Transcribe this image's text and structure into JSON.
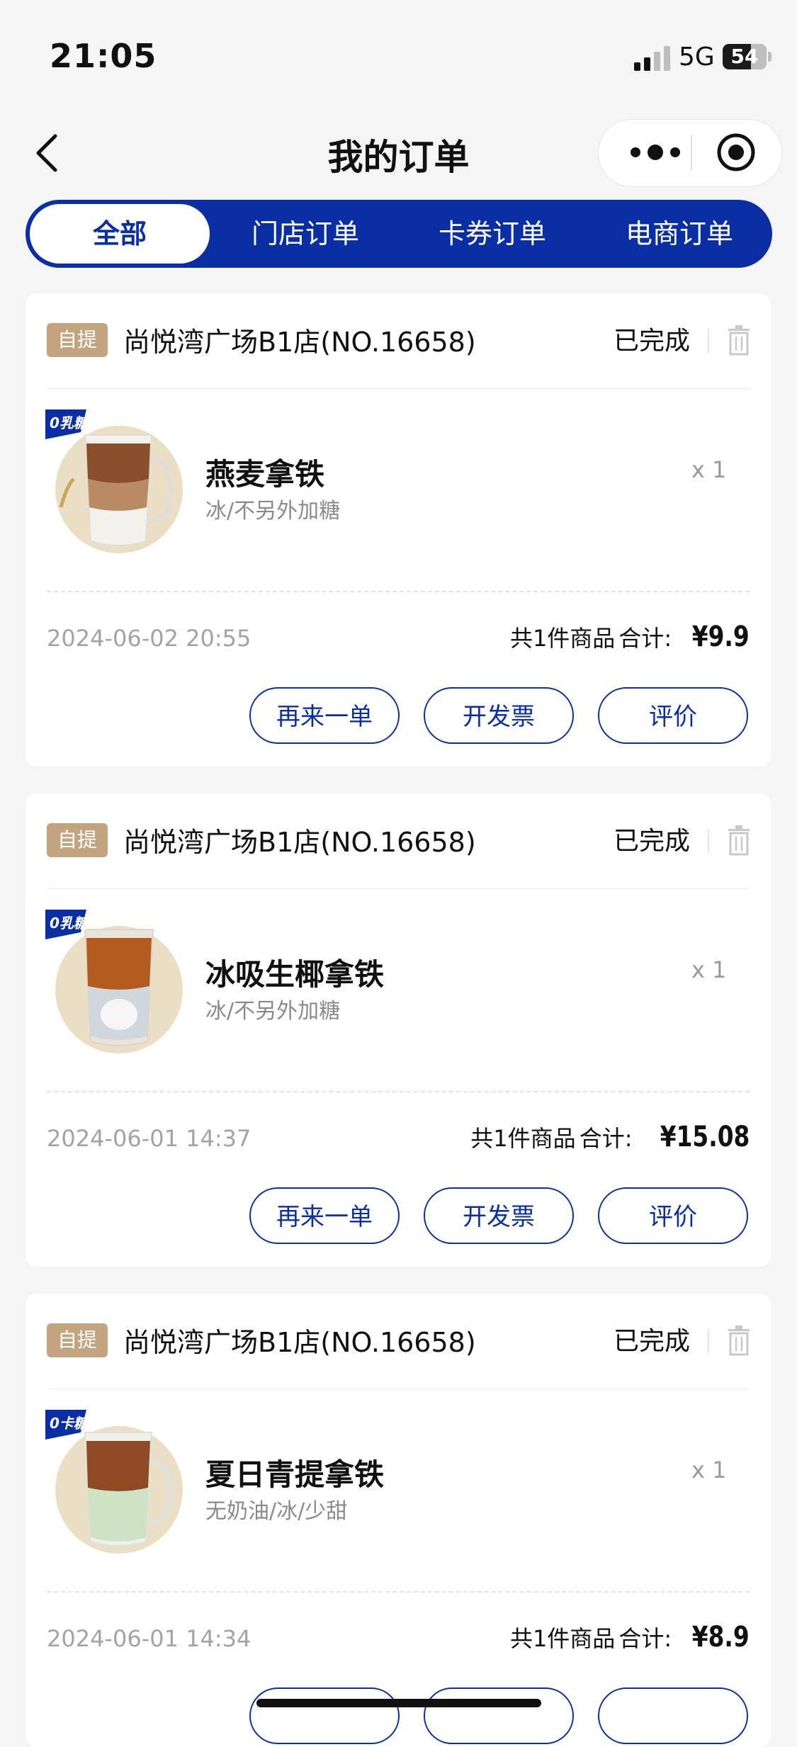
{
  "status_bar": {
    "time": "21:05",
    "network": "5G",
    "battery": "54"
  },
  "nav": {
    "title": "我的订单"
  },
  "tabs": [
    {
      "label": "全部",
      "active": true
    },
    {
      "label": "门店订单",
      "active": false
    },
    {
      "label": "卡券订单",
      "active": false
    },
    {
      "label": "电商订单",
      "active": false
    }
  ],
  "orders": [
    {
      "tag": "自提",
      "store": "尚悦湾广场B1店(NO.16658)",
      "status": "已完成",
      "badge": "0乳糖",
      "product": "燕麦拿铁",
      "spec": "冰/不另外加糖",
      "qty": "x 1",
      "date": "2024-06-02 20:55",
      "count_label": "共1件商品",
      "total_label": "合计:",
      "price": "¥9.9",
      "buttons": [
        "再来一单",
        "开发票",
        "评价"
      ]
    },
    {
      "tag": "自提",
      "store": "尚悦湾广场B1店(NO.16658)",
      "status": "已完成",
      "badge": "0乳糖",
      "product": "冰吸生椰拿铁",
      "spec": "冰/不另外加糖",
      "qty": "x 1",
      "date": "2024-06-01 14:37",
      "count_label": "共1件商品",
      "total_label": "合计:",
      "price": "¥15.08",
      "buttons": [
        "再来一单",
        "开发票",
        "评价"
      ]
    },
    {
      "tag": "自提",
      "store": "尚悦湾广场B1店(NO.16658)",
      "status": "已完成",
      "badge": "0卡糖",
      "product": "夏日青提拿铁",
      "spec": "无奶油/冰/少甜",
      "qty": "x 1",
      "date": "2024-06-01 14:34",
      "count_label": "共1件商品",
      "total_label": "合计:",
      "price": "¥8.9",
      "buttons": []
    }
  ],
  "colors": {
    "brand": "#0a2ea3",
    "tag": "#c2a57f",
    "background": "#f5f5f5"
  }
}
